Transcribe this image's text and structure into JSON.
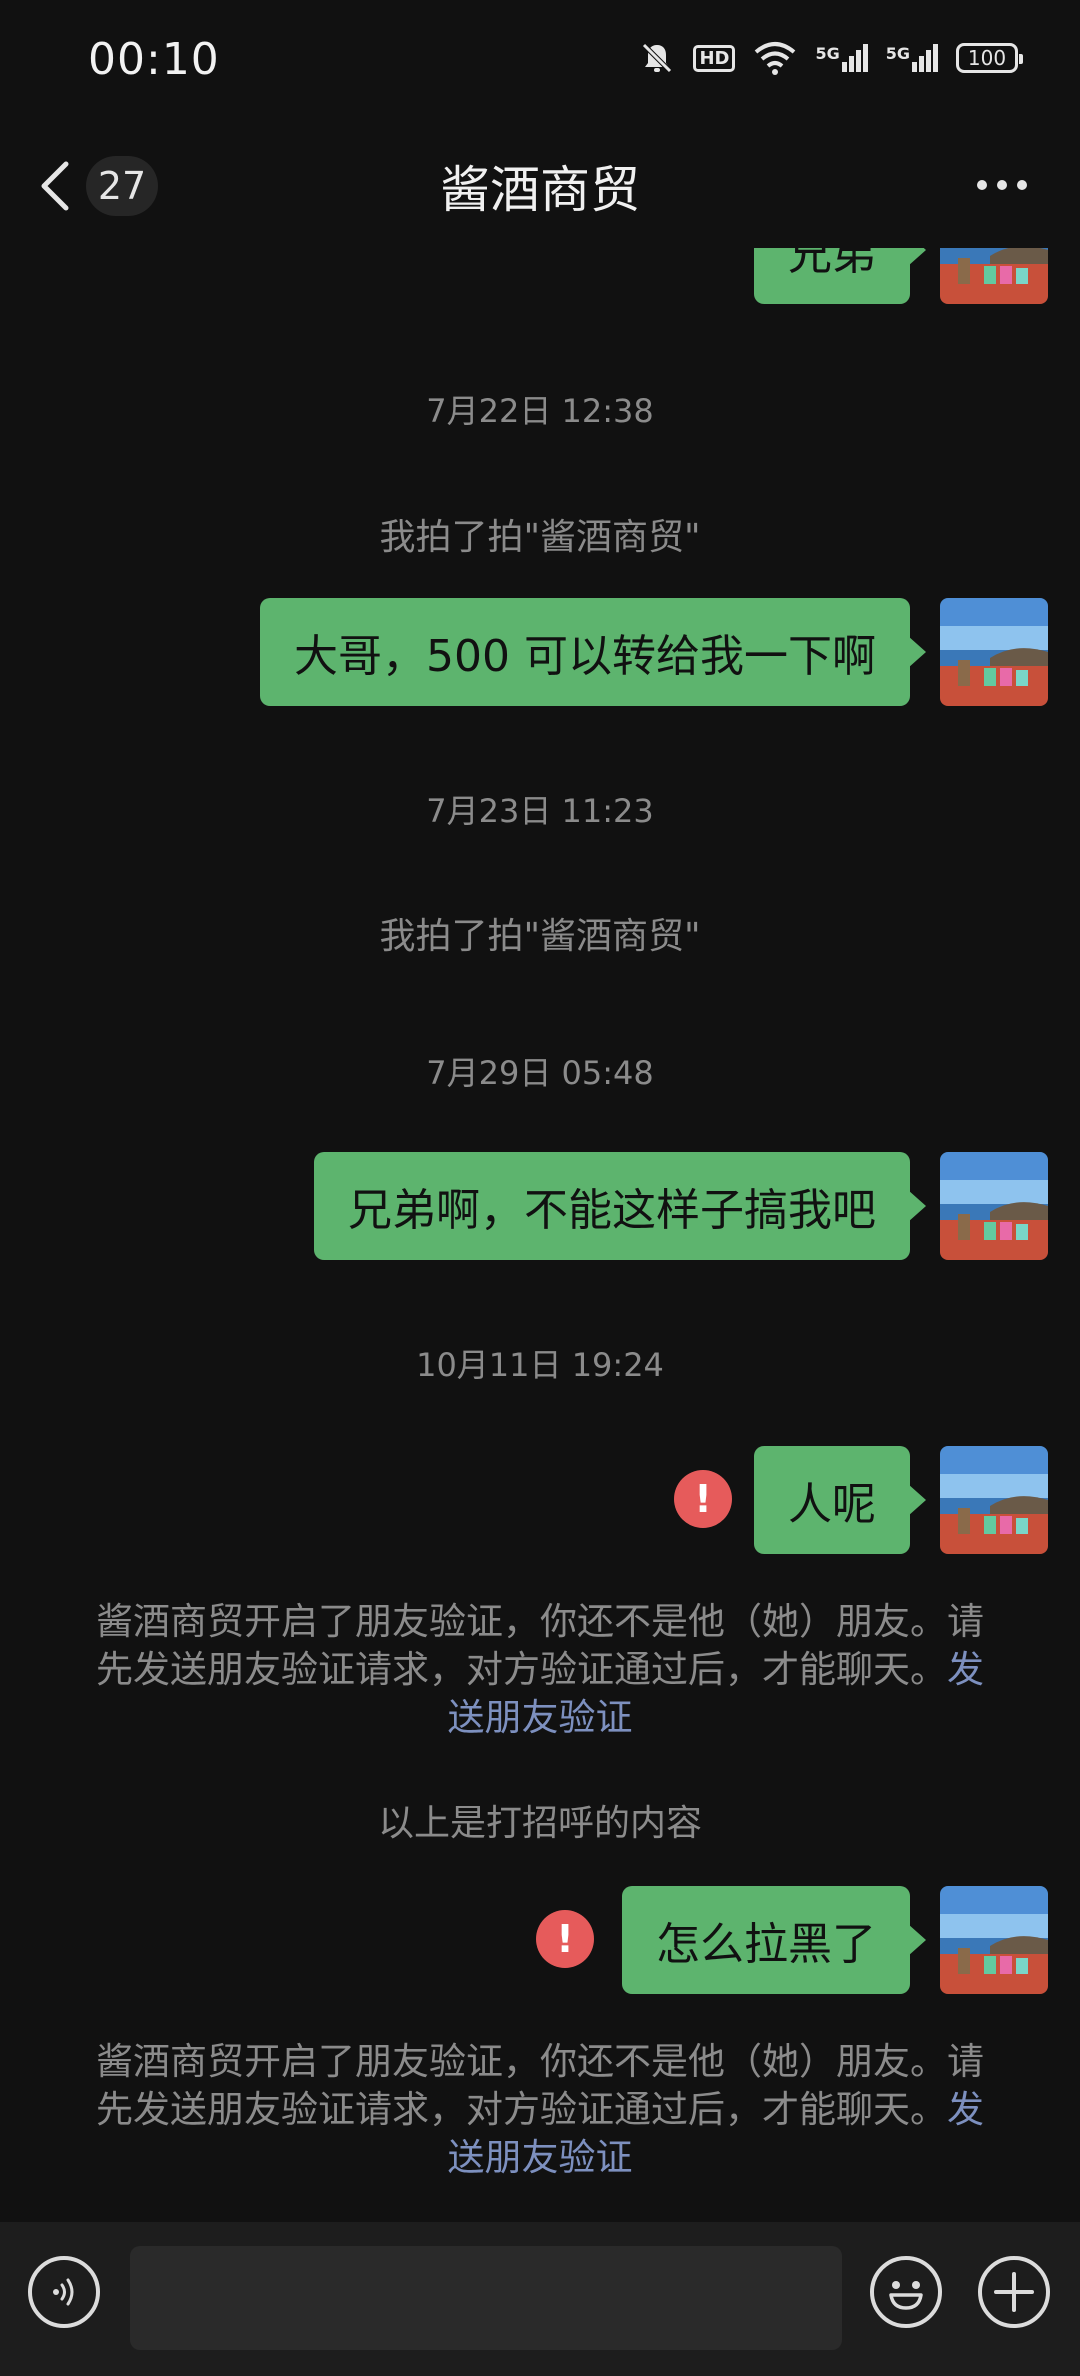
{
  "status_bar": {
    "time": "00:10",
    "hd_label": "HD",
    "net1": "5G",
    "net2": "5G",
    "battery": "100"
  },
  "nav": {
    "unread_count": "27",
    "title": "酱酒商贸"
  },
  "messages": {
    "partial_top_text": "兄弟",
    "ts1": "7月22日 12:38",
    "pat1": "我拍了拍\"酱酒商贸\"",
    "m1": "大哥，500 可以转给我一下啊",
    "ts2": "7月23日 11:23",
    "pat2": "我拍了拍\"酱酒商贸\"",
    "ts3": "7月29日 05:48",
    "m2": "兄弟啊，不能这样子搞我吧",
    "ts4": "10月11日 19:24",
    "m3": "人呢",
    "notice1_text": "酱酒商贸开启了朋友验证，你还不是他（她）朋友。请先发送朋友验证请求，对方验证通过后，才能聊天。",
    "notice1_link": "发送朋友验证",
    "greeting_note": "以上是打招呼的内容",
    "m4": "怎么拉黑了",
    "notice2_text": "酱酒商贸开启了朋友验证，你还不是他（她）朋友。请先发送朋友验证请求，对方验证通过后，才能聊天。",
    "notice2_link": "发送朋友验证",
    "error_mark": "!"
  },
  "colors": {
    "bubble": "#5db46e",
    "background": "#111111",
    "link": "#7d90bf",
    "error": "#e65b5b"
  },
  "icons": [
    "back-icon",
    "more-icon",
    "mute-icon",
    "wifi-icon",
    "signal-icon",
    "voice-icon",
    "emoji-icon",
    "plus-icon"
  ]
}
